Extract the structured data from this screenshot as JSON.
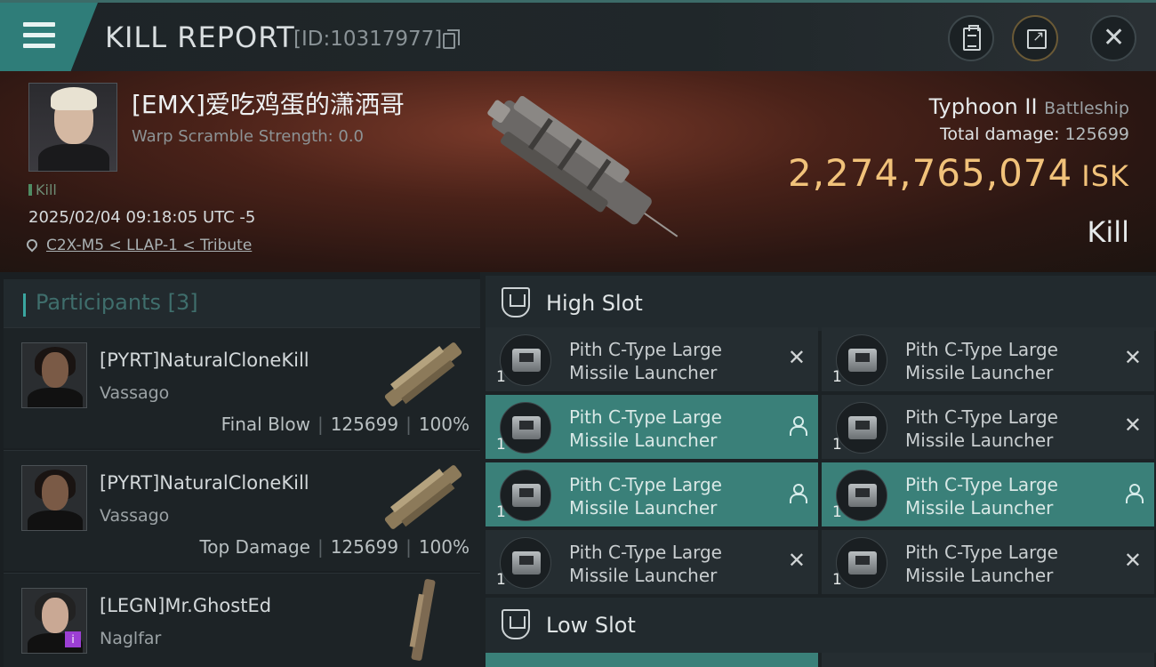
{
  "header": {
    "title": "KILL REPORT",
    "report_id": "[ID:10317977]"
  },
  "victim": {
    "name": "[EMX]爱吃鸡蛋的潇洒哥",
    "warp_scramble": "Warp Scramble Strength: 0.0",
    "kill_tag": "Kill",
    "timestamp": "2025/02/04 09:18:05 UTC -5",
    "location": "C2X-M5 < LLAP-1 < Tribute",
    "ship_name": "Typhoon II",
    "ship_class": "Battleship",
    "total_damage_label": "Total damage:",
    "total_damage": "125699",
    "isk_value": "2,274,765,074",
    "isk_unit": "ISK",
    "result_label": "Kill"
  },
  "participants": {
    "label": "Participants",
    "count": "[3]",
    "rows": [
      {
        "name": "[PYRT]NaturalCloneKill",
        "ship": "Vassago",
        "role": "Final Blow",
        "damage": "125699",
        "percent": "100%"
      },
      {
        "name": "[PYRT]NaturalCloneKill",
        "ship": "Vassago",
        "role": "Top Damage",
        "damage": "125699",
        "percent": "100%"
      },
      {
        "name": "[LEGN]Mr.GhostEd",
        "ship": "Naglfar"
      }
    ]
  },
  "slots": {
    "high_label": "High Slot",
    "low_label": "Low Slot",
    "modules": [
      {
        "line1": "Pith C-Type Large",
        "line2": "Missile Launcher",
        "qty": "1",
        "state": "destroyed"
      },
      {
        "line1": "Pith C-Type Large",
        "line2": "Missile Launcher",
        "qty": "1",
        "state": "destroyed"
      },
      {
        "line1": "Pith C-Type Large",
        "line2": "Missile Launcher",
        "qty": "1",
        "state": "dropped"
      },
      {
        "line1": "Pith C-Type Large",
        "line2": "Missile Launcher",
        "qty": "1",
        "state": "destroyed"
      },
      {
        "line1": "Pith C-Type Large",
        "line2": "Missile Launcher",
        "qty": "1",
        "state": "dropped"
      },
      {
        "line1": "Pith C-Type Large",
        "line2": "Missile Launcher",
        "qty": "1",
        "state": "dropped"
      },
      {
        "line1": "Pith C-Type Large",
        "line2": "Missile Launcher",
        "qty": "1",
        "state": "destroyed"
      },
      {
        "line1": "Pith C-Type Large",
        "line2": "Missile Launcher",
        "qty": "1",
        "state": "destroyed"
      }
    ]
  },
  "colors": {
    "accent": "#3a8079",
    "isk": "#f1c27a"
  }
}
